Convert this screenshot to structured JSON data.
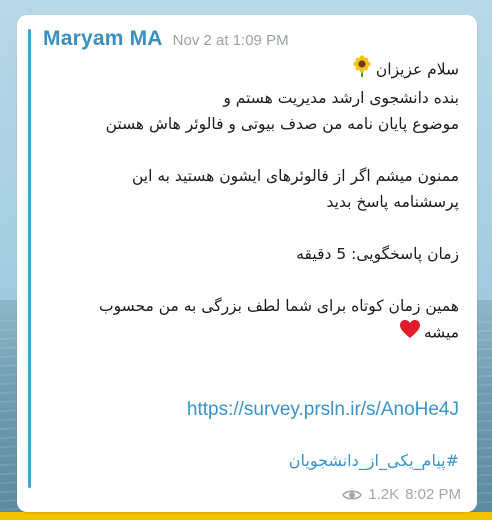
{
  "post": {
    "sender": "Maryam MA",
    "timestamp": "Nov 2 at 1:09 PM",
    "lines": [
      "سلام عزیزان",
      "بنده دانشجوی ارشد مدیریت هستم و",
      "موضوع پایان نامه من صدف بیوتی و فالوئر هاش هستن",
      "ممنون میشم اگر از فالوئرهای ایشون هستید به این",
      "پرسشنامه پاسخ بدید",
      "زمان پاسخگویی: 5 دقیقه",
      "همین زمان کوتاه برای شما لطف بزرگی به من محسوب",
      "میشه"
    ],
    "link": "https://survey.prsln.ir/s/AnoHe4J",
    "hashtag": "#پیام_یکی_از_دانشجویان",
    "views": "1.2K",
    "time": "8:02 PM",
    "icons": {
      "greeting": "sunflower-icon",
      "closing": "red-heart-icon",
      "views": "eye-icon"
    }
  },
  "colors": {
    "accent": "#41a4d6",
    "sender": "#3a8fc1",
    "link": "#3a93c8",
    "muted": "#9aa1a6",
    "bottom_strip": "#f2c200"
  }
}
